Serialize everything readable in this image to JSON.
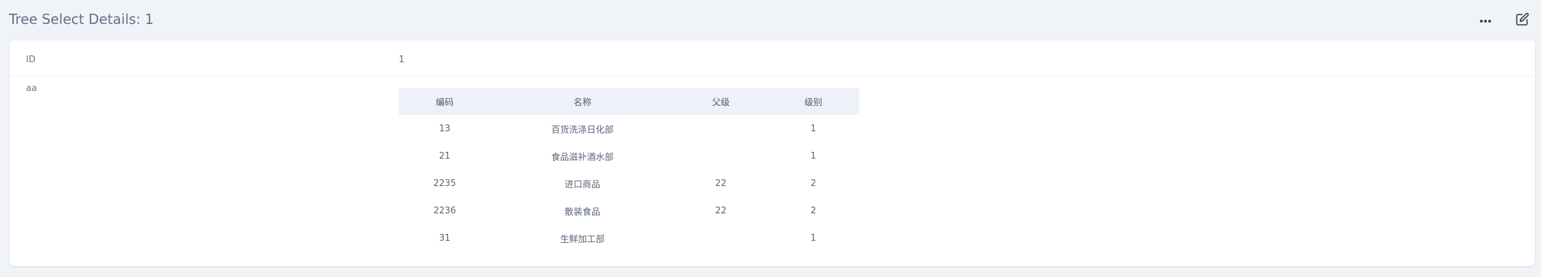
{
  "header": {
    "title": "Tree Select Details: 1",
    "more_icon": "more-horizontal-icon",
    "edit_icon": "edit-icon"
  },
  "fields": {
    "id_label": "ID",
    "id_value": "1",
    "aa_label": "aa"
  },
  "table": {
    "columns": [
      "编码",
      "名称",
      "父级",
      "级别"
    ],
    "rows": [
      {
        "code": "13",
        "name": "百货洗涤日化部",
        "parent": "",
        "level": "1"
      },
      {
        "code": "21",
        "name": "食品滋补酒水部",
        "parent": "",
        "level": "1"
      },
      {
        "code": "2235",
        "name": "进口商品",
        "parent": "22",
        "level": "2"
      },
      {
        "code": "2236",
        "name": "散装食品",
        "parent": "22",
        "level": "2"
      },
      {
        "code": "31",
        "name": "生鲜加工部",
        "parent": "",
        "level": "1"
      }
    ]
  },
  "colors": {
    "page_background": "#f0f3f8",
    "card_background": "#ffffff",
    "table_header_background": "#eef2f8",
    "text": "#5a6478",
    "icon": "#333a48"
  }
}
